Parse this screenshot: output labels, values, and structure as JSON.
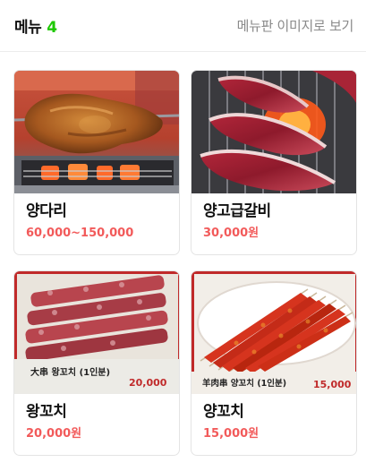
{
  "header": {
    "title": "메뉴",
    "count": "4",
    "view_image_link": "메뉴판 이미지로 보기"
  },
  "menu_items": [
    {
      "name": "양다리",
      "price": "60,000~150,000",
      "image": "roasted-lamb-leg-photo"
    },
    {
      "name": "양고급갈비",
      "price": "30,000원",
      "image": "raw-lamb-ribs-grill-photo"
    },
    {
      "name": "왕꼬치",
      "price": "20,000원",
      "image": "large-skewers-photo",
      "photo_caption": {
        "label": "大串 왕꼬치 (1인분)",
        "price": "20,000"
      }
    },
    {
      "name": "양꼬치",
      "price": "15,000원",
      "image": "lamb-skewers-photo",
      "photo_caption": {
        "label": "羊肉串 양꼬치 (1인분)",
        "price": "15,000"
      }
    }
  ],
  "colors": {
    "accent_count": "#1ec800",
    "price": "#f25a5a",
    "link": "#8a8a8a"
  }
}
